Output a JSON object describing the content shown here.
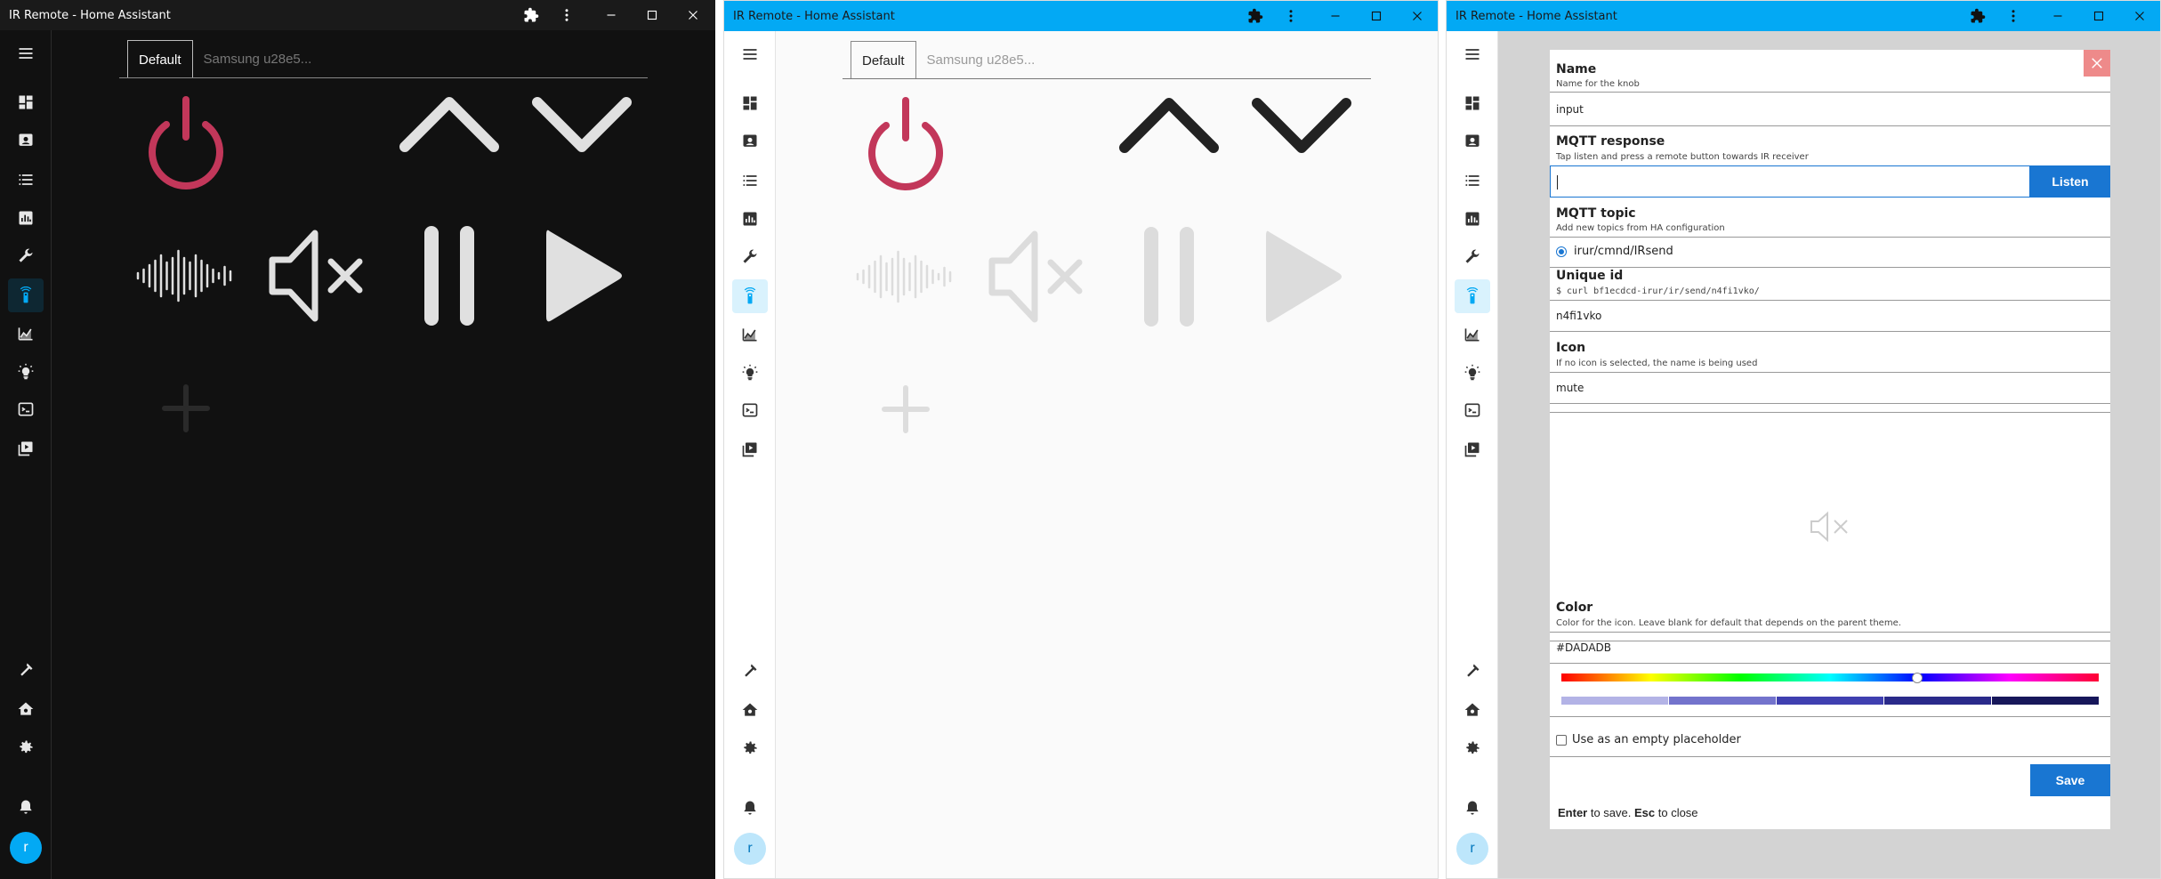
{
  "window_title": "IR Remote - Home Assistant",
  "tabs": {
    "default_label": "Default",
    "device_label": "Samsung u28e5..."
  },
  "user_initial": "r",
  "colors": {
    "accent": "#03a9f4",
    "power_red": "#c2375a",
    "save_blue": "#1976d2",
    "close_bg": "#ee8a8a"
  },
  "sidebar_icons": [
    "menu-icon",
    "dashboard-icon",
    "map-icon",
    "logbook-icon",
    "history-icon",
    "wrench-icon",
    "remote-icon",
    "energy-icon",
    "lightbulb-icon",
    "terminal-icon",
    "media-icon",
    "hammer-icon",
    "home-settings-icon",
    "gear-icon",
    "bell-icon"
  ],
  "remote_buttons": [
    "power",
    "up",
    "down",
    "voice",
    "mute",
    "pause",
    "play",
    "add"
  ],
  "dialog": {
    "name_title": "Name",
    "name_desc": "Name for the knob",
    "name_value": "input",
    "mqtt_title": "MQTT response",
    "mqtt_desc": "Tap listen and press a remote button towards IR receiver",
    "listen_label": "Listen",
    "topic_title": "MQTT topic",
    "topic_desc": "Add new topics from HA configuration",
    "topic_value": "irur/cmnd/IRsend",
    "uid_title": "Unique id",
    "uid_desc": "$ curl bf1ecdcd-irur/ir/send/n4fi1vko/",
    "uid_value": "n4fi1vko",
    "icon_title": "Icon",
    "icon_desc": "If no icon is selected, the name is being used",
    "icon_value": "mute",
    "color_title": "Color",
    "color_desc": "Color for the icon. Leave blank for default that depends on the parent theme.",
    "color_value": "#DADADB",
    "placeholder_label": "Use as an empty placeholder",
    "save_label": "Save",
    "hint_enter": "Enter",
    "hint_save": " to save. ",
    "hint_esc": "Esc",
    "hint_close": " to close",
    "shades": [
      "#b3b3e6",
      "#7373cc",
      "#3f3fb0",
      "#2a2a8a",
      "#17175a"
    ]
  }
}
